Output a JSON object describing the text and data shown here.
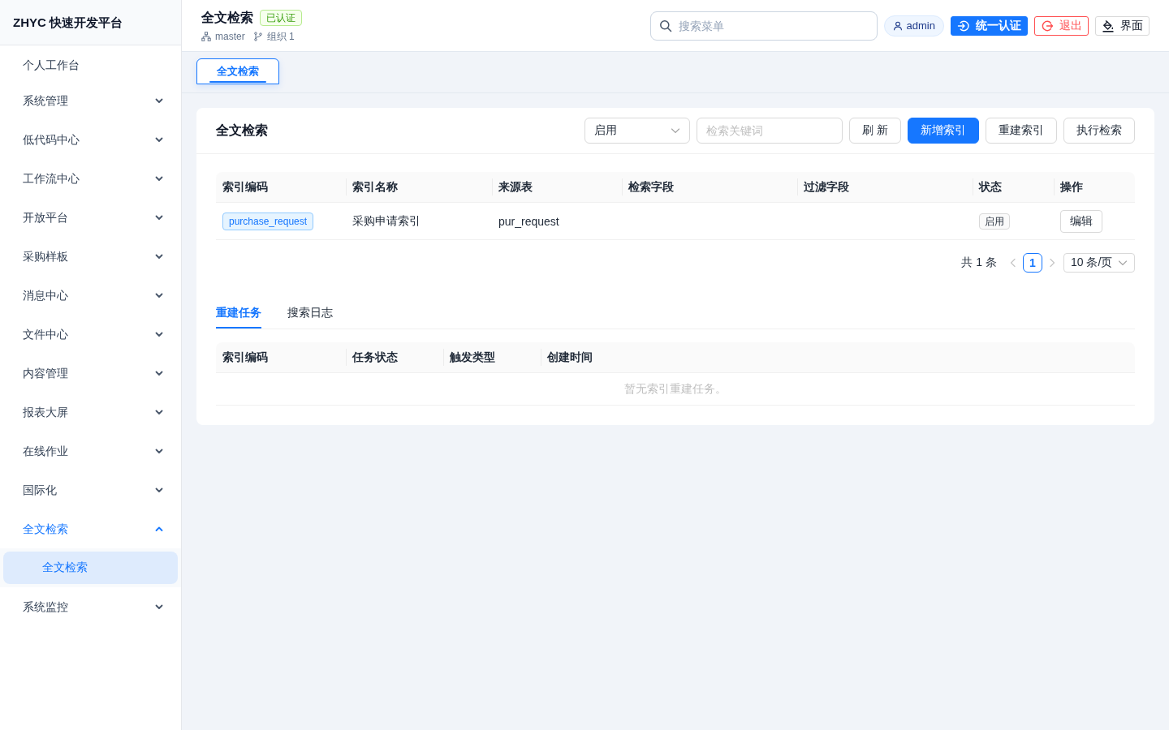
{
  "sidebar": {
    "brand": "ZHYC 快速开发平台",
    "items": [
      {
        "label": "个人工作台",
        "kind": "link",
        "selected": false
      },
      {
        "label": "系统管理",
        "kind": "group",
        "selected": false,
        "expanded": false
      },
      {
        "label": "低代码中心",
        "kind": "group",
        "selected": false,
        "expanded": false
      },
      {
        "label": "工作流中心",
        "kind": "group",
        "selected": false,
        "expanded": false
      },
      {
        "label": "开放平台",
        "kind": "group",
        "selected": false,
        "expanded": false
      },
      {
        "label": "采购样板",
        "kind": "group",
        "selected": false,
        "expanded": false
      },
      {
        "label": "消息中心",
        "kind": "group",
        "selected": false,
        "expanded": false
      },
      {
        "label": "文件中心",
        "kind": "group",
        "selected": false,
        "expanded": false
      },
      {
        "label": "内容管理",
        "kind": "group",
        "selected": false,
        "expanded": false
      },
      {
        "label": "报表大屏",
        "kind": "group",
        "selected": false,
        "expanded": false
      },
      {
        "label": "在线作业",
        "kind": "group",
        "selected": false,
        "expanded": false
      },
      {
        "label": "国际化",
        "kind": "group",
        "selected": false,
        "expanded": false
      },
      {
        "label": "全文检索",
        "kind": "group",
        "selected": true,
        "expanded": true,
        "children": [
          {
            "label": "全文检索",
            "selected": true
          }
        ]
      },
      {
        "label": "系统监控",
        "kind": "group",
        "selected": false,
        "expanded": false
      }
    ]
  },
  "header": {
    "title": "全文检索",
    "badge": "已认证",
    "meta": [
      {
        "kind": "node",
        "label": "master"
      },
      {
        "kind": "branch",
        "label": "组织 1"
      }
    ],
    "search": {
      "placeholder": "搜索菜单"
    },
    "user": {
      "label": "admin"
    },
    "actions": [
      {
        "kind": "primary",
        "label": "统一认证"
      },
      {
        "kind": "danger",
        "label": "退出"
      },
      {
        "kind": "default",
        "label": "界面"
      }
    ]
  },
  "tabs": [
    {
      "label": "全文检索",
      "selected": true
    }
  ],
  "panel": {
    "title": "全文检索",
    "status_filter": {
      "value": "启用"
    },
    "keyword": {
      "placeholder": "检索关键词"
    },
    "buttons": [
      {
        "kind": "default",
        "label": "刷 新"
      },
      {
        "kind": "primary",
        "label": "新增索引"
      },
      {
        "kind": "default",
        "label": "重建索引"
      },
      {
        "kind": "default",
        "label": "执行检索"
      }
    ],
    "index_table": {
      "columns": [
        "索引编码",
        "索引名称",
        "来源表",
        "检索字段",
        "过滤字段",
        "状态",
        "操作"
      ],
      "rows": [
        {
          "code": "purchase_request",
          "name": "采购申请索引",
          "source_table": "pur_request",
          "status": "启用",
          "action": "编辑"
        }
      ]
    },
    "pagination": {
      "total": "共 1 条",
      "previous": {
        "disabled": true
      },
      "pages": [
        {
          "label": "1",
          "selected": true
        }
      ],
      "next": {
        "disabled": true
      },
      "page_size": "10 条/页"
    },
    "sub_tabs": [
      {
        "label": "重建任务",
        "selected": true
      },
      {
        "label": "搜索日志",
        "selected": false
      }
    ],
    "task_table": {
      "columns": [
        "索引编码",
        "任务状态",
        "触发类型",
        "创建时间"
      ],
      "empty_text": "暂无索引重建任务。"
    }
  }
}
